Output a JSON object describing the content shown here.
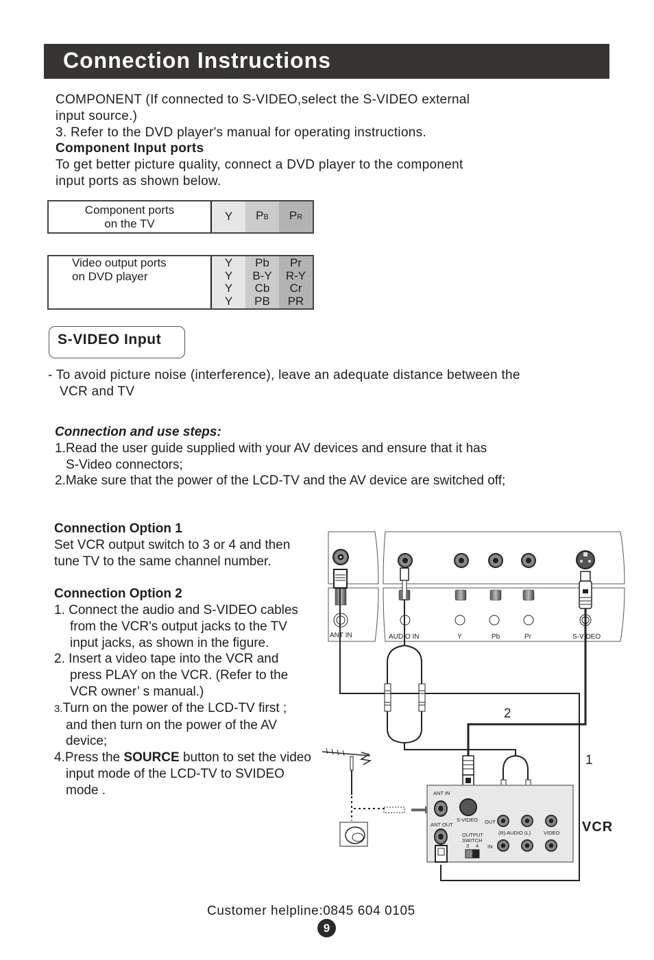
{
  "header": {
    "title": "Connection Instructions"
  },
  "intro": {
    "line1": "COMPONENT (If connected to S-VIDEO,select the S-VIDEO external",
    "line2": "input source.)",
    "line3": "3. Refer to the DVD player's manual for operating instructions.",
    "heading": "Component Input ports",
    "line4": "To get better picture quality, connect a DVD player to the component",
    "line5": "input ports as shown below."
  },
  "tv_table": {
    "label_line1": "Component ports",
    "label_line2": "on the TV",
    "columns": [
      {
        "main": "Y",
        "sub": ""
      },
      {
        "main": "P",
        "sub": "B"
      },
      {
        "main": "P",
        "sub": "R"
      }
    ]
  },
  "dvd_table": {
    "label_line1": "Video output ports",
    "label_line2": "on DVD player",
    "columns": [
      {
        "rows": [
          "Y",
          "Y",
          "Y",
          "Y"
        ]
      },
      {
        "rows": [
          "Pb",
          "B-Y",
          "Cb",
          "PB"
        ]
      },
      {
        "rows": [
          "Pr",
          "R-Y",
          "Cr",
          "PR"
        ]
      }
    ]
  },
  "svideo_section": {
    "title": "S-VIDEO Input",
    "note_line1": "- To avoid picture noise (interference), leave an adequate distance between the",
    "note_line2": "VCR and TV",
    "steps_heading": "Connection and use steps:",
    "step1_line1": "1.Read the user guide supplied with your AV devices and ensure that it has",
    "step1_line2": "S-Video connectors;",
    "step2": "2.Make sure that the power of the LCD-TV and the AV device are switched off;"
  },
  "option1": {
    "heading": "Connection Option 1",
    "line1": "Set VCR output switch to 3 or 4 and then",
    "line2": "tune TV to the same channel number."
  },
  "option2": {
    "heading": "Connection Option 2",
    "s1_l1": "1. Connect the audio and S-VIDEO cables",
    "s1_l2": "from the VCR's output jacks to the TV",
    "s1_l3": "input jacks, as shown in the figure.",
    "s2_l1": "2. Insert a video tape into the VCR and",
    "s2_l2": "press PLAY on the VCR. (Refer to the",
    "s2_l3": "VCR owner’ s manual.)",
    "s3_num": "3.",
    "s3_l1": "Turn on the power of the LCD-TV first ;",
    "s3_l2": "and then turn on the power of the AV",
    "s3_l3": "device;",
    "s4_pre": "4.Press the ",
    "s4_bold": "SOURCE",
    "s4_post": " button to set the video",
    "s4_l2": "input mode of the LCD-TV to SVIDEO",
    "s4_l3": "mode ."
  },
  "diagram": {
    "tv_labels": [
      "ANT IN",
      "AUDIO IN",
      "Y",
      "Pb",
      "Pr",
      "S-VIDEO"
    ],
    "cable_labels": {
      "cable2": "2",
      "cable1": "1"
    },
    "vcr_panel": {
      "ant_in": "ANT IN",
      "ant_out": "ANT OUT",
      "svideo": "S-VIDEO",
      "out": "OUT",
      "in": "IN",
      "audio": "(R) AUDIO (L)",
      "video": "VIDEO",
      "output_switch_l1": "OUTPUT",
      "output_switch_l2": "SWITCH",
      "switch_3": "3",
      "switch_4": "4"
    },
    "vcr_label": "VCR"
  },
  "footer": {
    "helpline": "Customer helpline:0845 604 0105",
    "page_number": "9"
  }
}
